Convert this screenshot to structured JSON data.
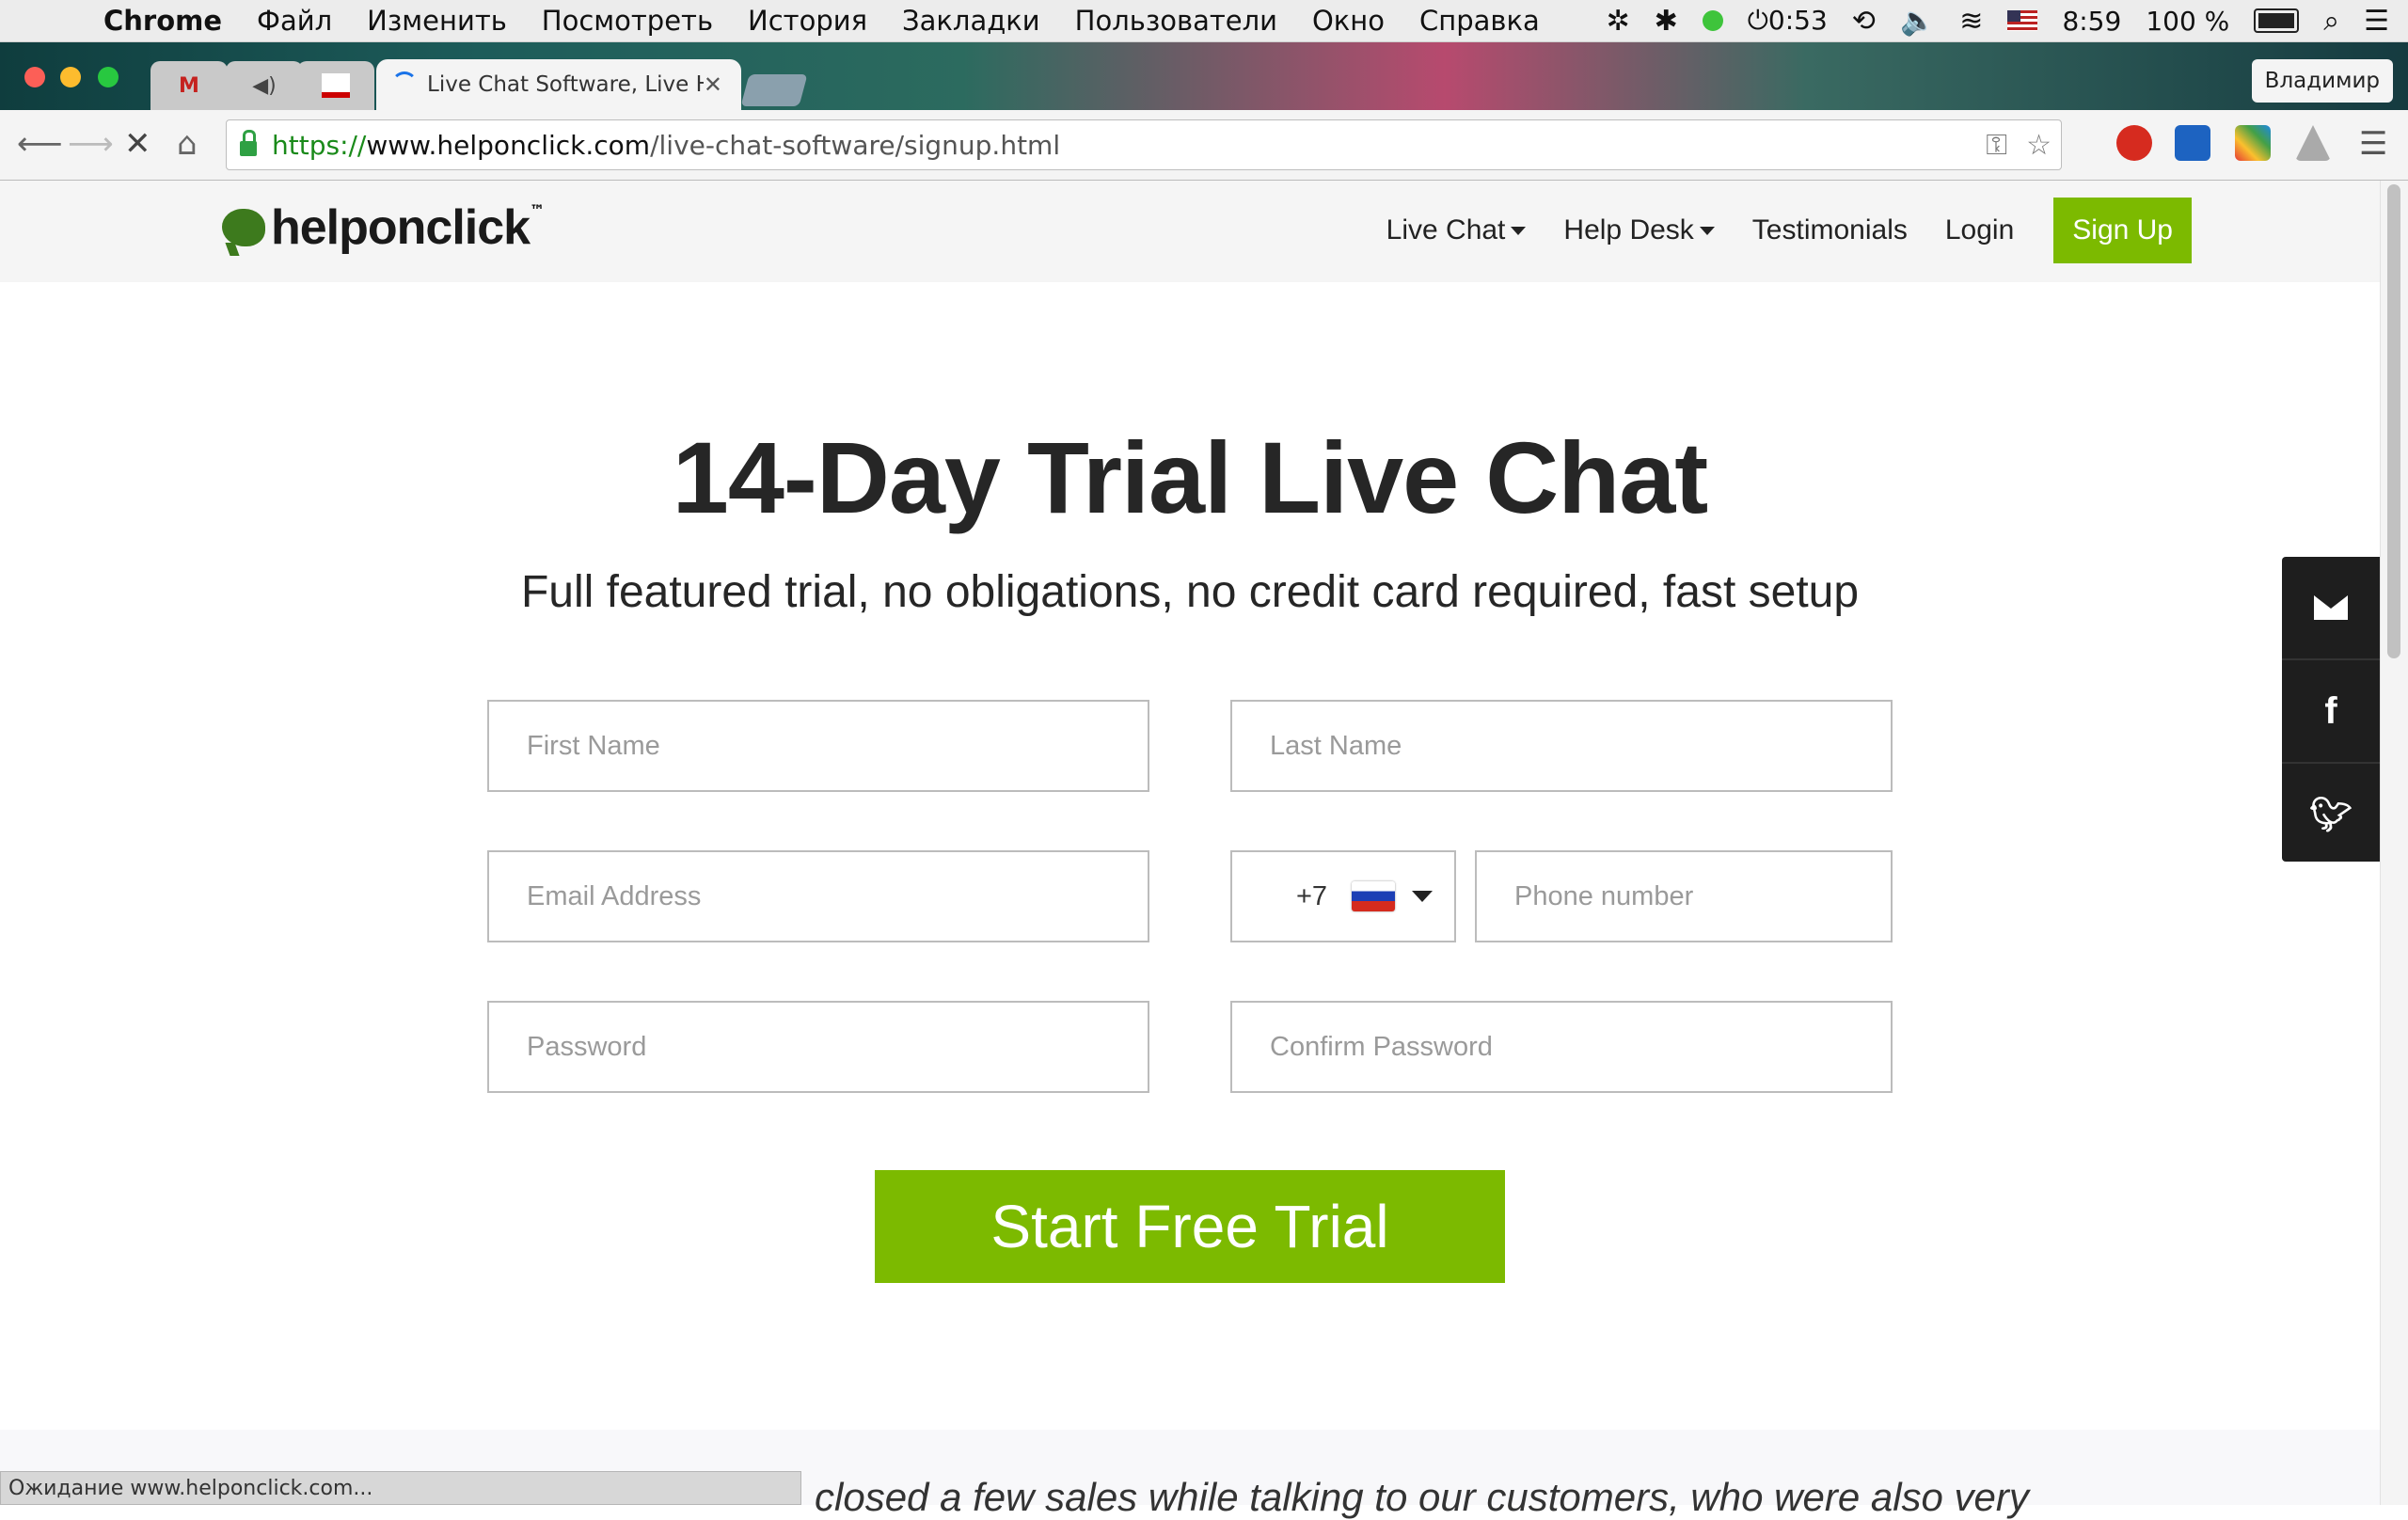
{
  "menubar": {
    "app_name": "Chrome",
    "items": [
      "Файл",
      "Изменить",
      "Посмотреть",
      "История",
      "Закладки",
      "Пользователи",
      "Окно",
      "Справка"
    ],
    "timer": "0:53",
    "clock": "8:59",
    "battery": "100 %"
  },
  "browser": {
    "active_tab_title": "Live Chat Software, Live He",
    "profile_name": "Владимир",
    "url_scheme": "https://",
    "url_host": "www.helponclick.com",
    "url_path": "/live-chat-software/signup.html",
    "status_text": "Ожидание www.helponclick.com..."
  },
  "site": {
    "logo_text": "helponclick",
    "logo_tm": "™",
    "nav": {
      "live_chat": "Live Chat",
      "help_desk": "Help Desk",
      "testimonials": "Testimonials",
      "login": "Login",
      "signup": "Sign Up"
    }
  },
  "form": {
    "title": "14-Day Trial Live Chat",
    "subtitle": "Full featured trial, no obligations, no credit card required, fast setup",
    "first_name_placeholder": "First Name",
    "last_name_placeholder": "Last Name",
    "email_placeholder": "Email Address",
    "country_code": "+7",
    "phone_placeholder": "Phone number",
    "password_placeholder": "Password",
    "confirm_password_placeholder": "Confirm Password",
    "submit_label": "Start Free Trial"
  },
  "testimonial_fragment": "closed a few sales while talking to our customers, who were also very",
  "colors": {
    "brand_green": "#7cba00",
    "dark_text": "#262626",
    "social_bar": "#1e1e1e"
  }
}
